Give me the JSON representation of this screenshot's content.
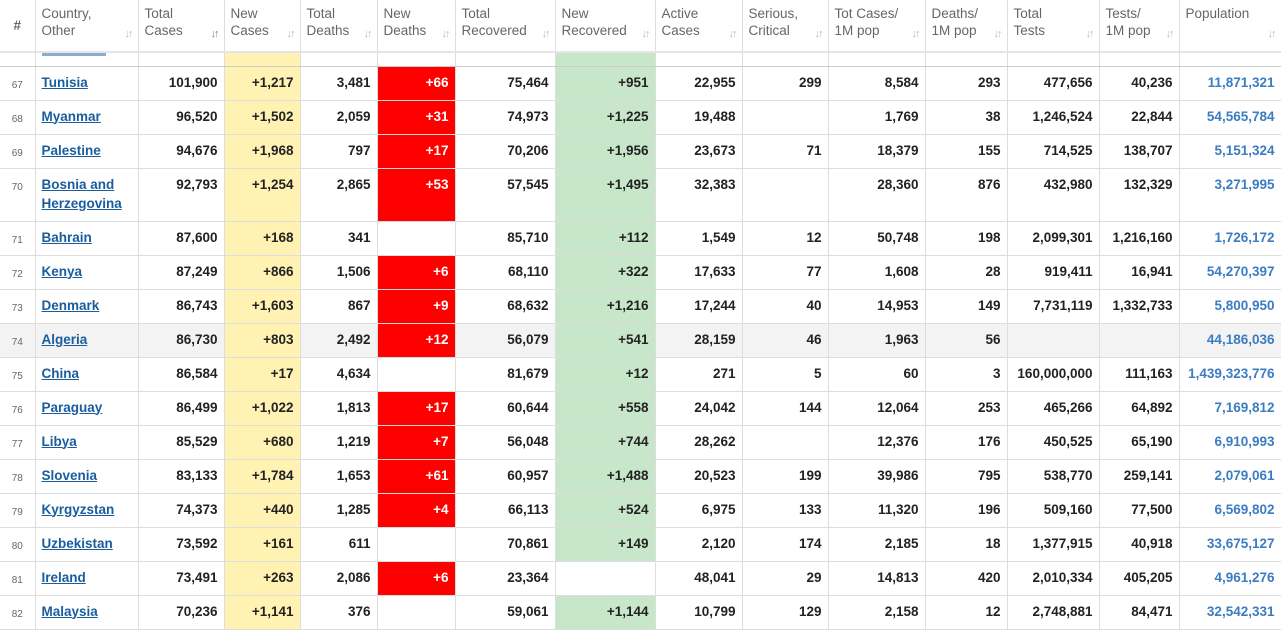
{
  "headers": [
    {
      "l1": "#",
      "l2": ""
    },
    {
      "l1": "Country,",
      "l2": "Other"
    },
    {
      "l1": "Total",
      "l2": "Cases"
    },
    {
      "l1": "New",
      "l2": "Cases"
    },
    {
      "l1": "Total",
      "l2": "Deaths"
    },
    {
      "l1": "New",
      "l2": "Deaths"
    },
    {
      "l1": "Total",
      "l2": "Recovered"
    },
    {
      "l1": "New",
      "l2": "Recovered"
    },
    {
      "l1": "Active",
      "l2": "Cases"
    },
    {
      "l1": "Serious,",
      "l2": "Critical"
    },
    {
      "l1": "Tot Cases/",
      "l2": "1M pop"
    },
    {
      "l1": "Deaths/",
      "l2": "1M pop"
    },
    {
      "l1": "Total",
      "l2": "Tests"
    },
    {
      "l1": "Tests/",
      "l2": "1M pop"
    },
    {
      "l1": "Population",
      "l2": ""
    }
  ],
  "colors": {
    "new_cases": "#fff2b3",
    "new_deaths": "#ff0000",
    "new_recovered": "#c8e6c9",
    "link": "#1a5d9e",
    "population": "#3b7cc2"
  },
  "rows": [
    {
      "rank": "67",
      "country": "Tunisia",
      "total_cases": "101,900",
      "new_cases": "+1,217",
      "total_deaths": "3,481",
      "new_deaths": "+66",
      "total_recovered": "75,464",
      "new_recovered": "+951",
      "active": "22,955",
      "serious": "299",
      "cases_1m": "8,584",
      "deaths_1m": "293",
      "tests": "477,656",
      "tests_1m": "40,236",
      "population": "11,871,321"
    },
    {
      "rank": "68",
      "country": "Myanmar",
      "total_cases": "96,520",
      "new_cases": "+1,502",
      "total_deaths": "2,059",
      "new_deaths": "+31",
      "total_recovered": "74,973",
      "new_recovered": "+1,225",
      "active": "19,488",
      "serious": "",
      "cases_1m": "1,769",
      "deaths_1m": "38",
      "tests": "1,246,524",
      "tests_1m": "22,844",
      "population": "54,565,784"
    },
    {
      "rank": "69",
      "country": "Palestine",
      "total_cases": "94,676",
      "new_cases": "+1,968",
      "total_deaths": "797",
      "new_deaths": "+17",
      "total_recovered": "70,206",
      "new_recovered": "+1,956",
      "active": "23,673",
      "serious": "71",
      "cases_1m": "18,379",
      "deaths_1m": "155",
      "tests": "714,525",
      "tests_1m": "138,707",
      "population": "5,151,324"
    },
    {
      "rank": "70",
      "country": "Bosnia and Herzegovina",
      "total_cases": "92,793",
      "new_cases": "+1,254",
      "total_deaths": "2,865",
      "new_deaths": "+53",
      "total_recovered": "57,545",
      "new_recovered": "+1,495",
      "active": "32,383",
      "serious": "",
      "cases_1m": "28,360",
      "deaths_1m": "876",
      "tests": "432,980",
      "tests_1m": "132,329",
      "population": "3,271,995"
    },
    {
      "rank": "71",
      "country": "Bahrain",
      "total_cases": "87,600",
      "new_cases": "+168",
      "total_deaths": "341",
      "new_deaths": "",
      "total_recovered": "85,710",
      "new_recovered": "+112",
      "active": "1,549",
      "serious": "12",
      "cases_1m": "50,748",
      "deaths_1m": "198",
      "tests": "2,099,301",
      "tests_1m": "1,216,160",
      "population": "1,726,172"
    },
    {
      "rank": "72",
      "country": "Kenya",
      "total_cases": "87,249",
      "new_cases": "+866",
      "total_deaths": "1,506",
      "new_deaths": "+6",
      "total_recovered": "68,110",
      "new_recovered": "+322",
      "active": "17,633",
      "serious": "77",
      "cases_1m": "1,608",
      "deaths_1m": "28",
      "tests": "919,411",
      "tests_1m": "16,941",
      "population": "54,270,397"
    },
    {
      "rank": "73",
      "country": "Denmark",
      "total_cases": "86,743",
      "new_cases": "+1,603",
      "total_deaths": "867",
      "new_deaths": "+9",
      "total_recovered": "68,632",
      "new_recovered": "+1,216",
      "active": "17,244",
      "serious": "40",
      "cases_1m": "14,953",
      "deaths_1m": "149",
      "tests": "7,731,119",
      "tests_1m": "1,332,733",
      "population": "5,800,950"
    },
    {
      "rank": "74",
      "country": "Algeria",
      "total_cases": "86,730",
      "new_cases": "+803",
      "total_deaths": "2,492",
      "new_deaths": "+12",
      "total_recovered": "56,079",
      "new_recovered": "+541",
      "active": "28,159",
      "serious": "46",
      "cases_1m": "1,963",
      "deaths_1m": "56",
      "tests": "",
      "tests_1m": "",
      "population": "44,186,036"
    },
    {
      "rank": "75",
      "country": "China",
      "total_cases": "86,584",
      "new_cases": "+17",
      "total_deaths": "4,634",
      "new_deaths": "",
      "total_recovered": "81,679",
      "new_recovered": "+12",
      "active": "271",
      "serious": "5",
      "cases_1m": "60",
      "deaths_1m": "3",
      "tests": "160,000,000",
      "tests_1m": "111,163",
      "population": "1,439,323,776"
    },
    {
      "rank": "76",
      "country": "Paraguay",
      "total_cases": "86,499",
      "new_cases": "+1,022",
      "total_deaths": "1,813",
      "new_deaths": "+17",
      "total_recovered": "60,644",
      "new_recovered": "+558",
      "active": "24,042",
      "serious": "144",
      "cases_1m": "12,064",
      "deaths_1m": "253",
      "tests": "465,266",
      "tests_1m": "64,892",
      "population": "7,169,812"
    },
    {
      "rank": "77",
      "country": "Libya",
      "total_cases": "85,529",
      "new_cases": "+680",
      "total_deaths": "1,219",
      "new_deaths": "+7",
      "total_recovered": "56,048",
      "new_recovered": "+744",
      "active": "28,262",
      "serious": "",
      "cases_1m": "12,376",
      "deaths_1m": "176",
      "tests": "450,525",
      "tests_1m": "65,190",
      "population": "6,910,993"
    },
    {
      "rank": "78",
      "country": "Slovenia",
      "total_cases": "83,133",
      "new_cases": "+1,784",
      "total_deaths": "1,653",
      "new_deaths": "+61",
      "total_recovered": "60,957",
      "new_recovered": "+1,488",
      "active": "20,523",
      "serious": "199",
      "cases_1m": "39,986",
      "deaths_1m": "795",
      "tests": "538,770",
      "tests_1m": "259,141",
      "population": "2,079,061"
    },
    {
      "rank": "79",
      "country": "Kyrgyzstan",
      "total_cases": "74,373",
      "new_cases": "+440",
      "total_deaths": "1,285",
      "new_deaths": "+4",
      "total_recovered": "66,113",
      "new_recovered": "+524",
      "active": "6,975",
      "serious": "133",
      "cases_1m": "11,320",
      "deaths_1m": "196",
      "tests": "509,160",
      "tests_1m": "77,500",
      "population": "6,569,802"
    },
    {
      "rank": "80",
      "country": "Uzbekistan",
      "total_cases": "73,592",
      "new_cases": "+161",
      "total_deaths": "611",
      "new_deaths": "",
      "total_recovered": "70,861",
      "new_recovered": "+149",
      "active": "2,120",
      "serious": "174",
      "cases_1m": "2,185",
      "deaths_1m": "18",
      "tests": "1,377,915",
      "tests_1m": "40,918",
      "population": "33,675,127"
    },
    {
      "rank": "81",
      "country": "Ireland",
      "total_cases": "73,491",
      "new_cases": "+263",
      "total_deaths": "2,086",
      "new_deaths": "+6",
      "total_recovered": "23,364",
      "new_recovered": "",
      "active": "48,041",
      "serious": "29",
      "cases_1m": "14,813",
      "deaths_1m": "420",
      "tests": "2,010,334",
      "tests_1m": "405,205",
      "population": "4,961,276"
    },
    {
      "rank": "82",
      "country": "Malaysia",
      "total_cases": "70,236",
      "new_cases": "+1,141",
      "total_deaths": "376",
      "new_deaths": "",
      "total_recovered": "59,061",
      "new_recovered": "+1,144",
      "active": "10,799",
      "serious": "129",
      "cases_1m": "2,158",
      "deaths_1m": "12",
      "tests": "2,748,881",
      "tests_1m": "84,471",
      "population": "32,542,331"
    }
  ]
}
